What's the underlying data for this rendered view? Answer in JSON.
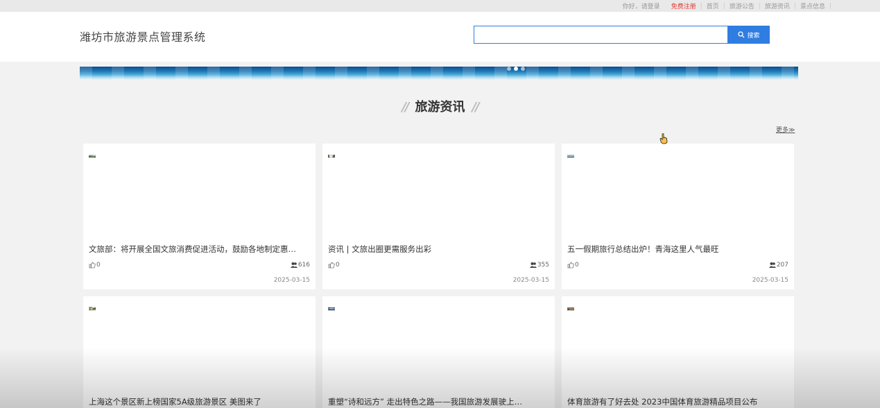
{
  "topbar": {
    "greeting": "你好，请登录",
    "register": "免费注册",
    "links": [
      "首页",
      "旅游公告",
      "旅游资讯",
      "景点信息"
    ]
  },
  "header": {
    "site_title": "潍坊市旅游景点管理系统",
    "search": {
      "value": "",
      "placeholder": "",
      "button_label": "搜索"
    }
  },
  "section": {
    "title": "旅游资讯",
    "more_label": "更多≫"
  },
  "articles": [
    {
      "title": "文旅部：将开展全国文旅消费促进活动，鼓励各地制定惠…",
      "likes": "0",
      "views": "616",
      "date": "2025-03-15"
    },
    {
      "title": "资讯 | 文旅出圈更需服务出彩",
      "likes": "0",
      "views": "355",
      "date": "2025-03-15"
    },
    {
      "title": "五一假期旅行总结出炉！青海这里人气最旺",
      "likes": "0",
      "views": "207",
      "date": "2025-03-15"
    },
    {
      "title": "上海这个景区新上榜国家5A级旅游景区 美图来了",
      "likes": "",
      "views": "",
      "date": ""
    },
    {
      "title": "重塑“诗和远方” 走出特色之路——我国旅游发展驶上…",
      "likes": "",
      "views": "",
      "date": ""
    },
    {
      "title": "体育旅游有了好去处 2023中国体育旅游精品项目公布",
      "likes": "",
      "views": "",
      "date": ""
    }
  ],
  "colors": {
    "accent": "#2f7de1",
    "register": "#e53935"
  }
}
